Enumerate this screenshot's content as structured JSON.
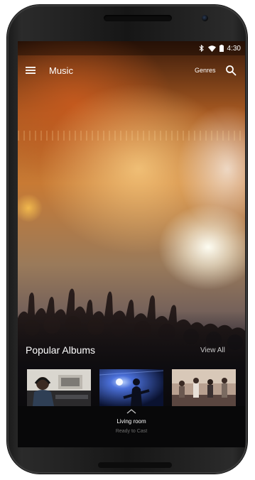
{
  "status_bar": {
    "time": "4:30",
    "icons": [
      "bluetooth-icon",
      "wifi-icon",
      "battery-icon"
    ]
  },
  "toolbar": {
    "menu_icon": "menu-icon",
    "title": "Music",
    "genres_label": "Genres",
    "search_icon": "search-icon"
  },
  "popular": {
    "title": "Popular Albums",
    "view_all_label": "View All",
    "albums": [
      {
        "art": "studio-recording-headphones"
      },
      {
        "art": "guitarist-blue-stage-lights"
      },
      {
        "art": "band-group-on-stage"
      }
    ]
  },
  "cast": {
    "expand_icon": "chevron-up-icon",
    "device": "Living room",
    "status": "Ready to Cast"
  },
  "colors": {
    "screen_bg": "#111111",
    "text_primary": "#ffffff",
    "text_secondary": "#c8c8c8",
    "cast_status": "#6f6f6f",
    "phone_body": "#1c1c1c"
  }
}
